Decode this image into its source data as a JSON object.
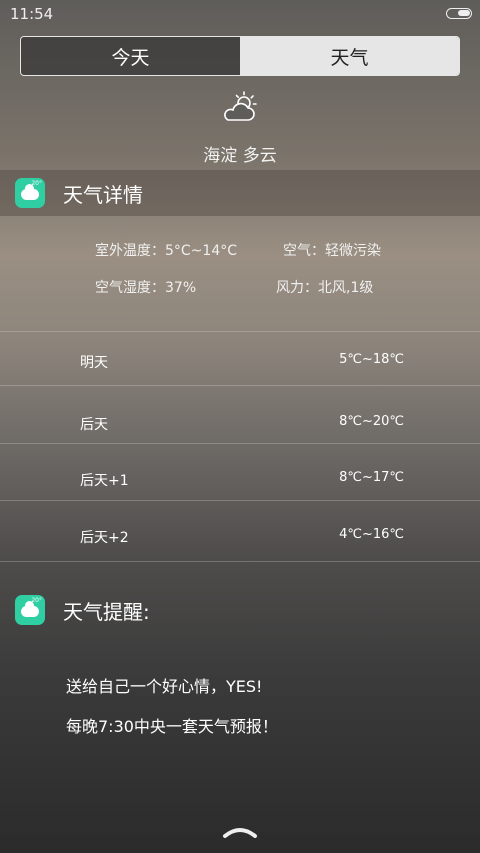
{
  "status_bar": {
    "time": "11:54",
    "battery_level": 0.5
  },
  "tabs": [
    {
      "label": "今天",
      "active": true
    },
    {
      "label": "天气",
      "active": false
    }
  ],
  "current": {
    "location_condition": "海淀 多云",
    "icon": "partly-cloudy-icon"
  },
  "details_section": {
    "title": "天气详情",
    "outdoor_temp": "室外温度：5°C~14°C",
    "air": "空气：轻微污染",
    "humidity": "空气湿度：37%",
    "wind": "风力：北风,1级"
  },
  "forecast": [
    {
      "day": "明天",
      "temp": "5℃~18℃"
    },
    {
      "day": "后天",
      "temp": "8℃~20℃"
    },
    {
      "day": "后天+1",
      "temp": "8℃~17℃"
    },
    {
      "day": "后天+2",
      "temp": "4℃~16℃"
    }
  ],
  "reminder_section": {
    "title": "天气提醒:",
    "lines": [
      "送给自己一个好心情，YES!",
      "每晚7:30中央一套天气预报！"
    ]
  },
  "colors": {
    "accent": "#2fcfa3",
    "tab_inactive_bg": "#e6e6e6"
  }
}
